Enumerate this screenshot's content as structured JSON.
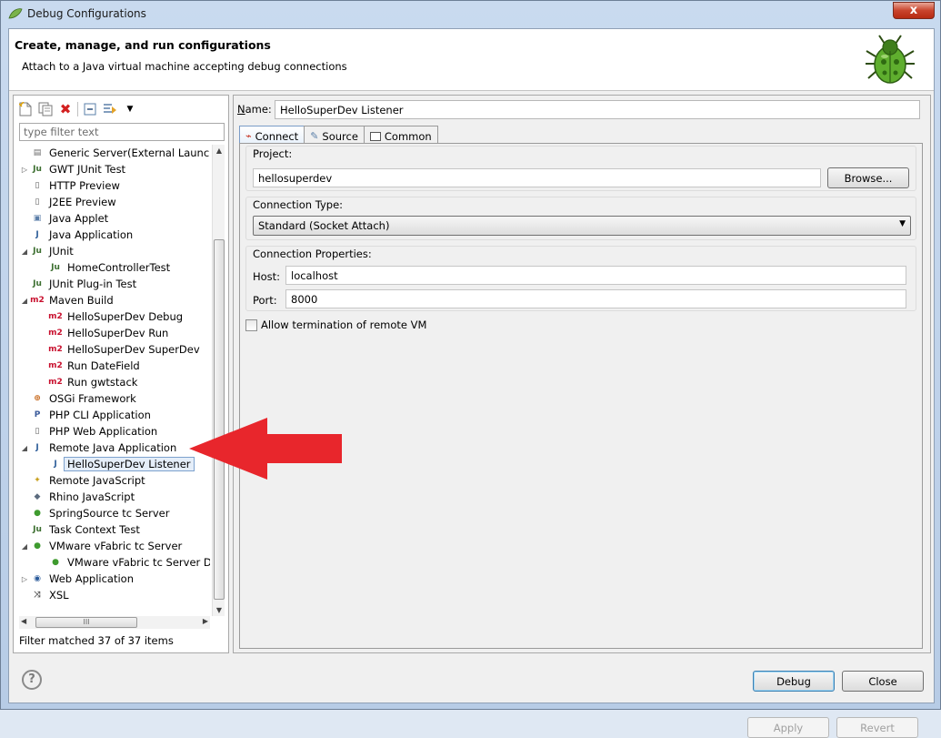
{
  "window": {
    "title": "Debug Configurations",
    "close_label": "x"
  },
  "header": {
    "title": "Create, manage, and run configurations",
    "subtitle": "Attach to a Java virtual machine accepting debug connections",
    "icon": "bug-icon"
  },
  "left": {
    "toolbar_icons": [
      "new-configuration-icon",
      "duplicate-icon",
      "delete-icon",
      "collapse-all-icon",
      "filter-icon",
      "dropdown-icon"
    ],
    "filter_placeholder": "type filter text",
    "tree": [
      {
        "label": "Generic Server(External Launch)",
        "icon": "server-icon",
        "level": 0,
        "twisty": "",
        "selected": false
      },
      {
        "label": "GWT JUnit Test",
        "icon": "junit-icon",
        "level": 0,
        "twisty": "closed",
        "selected": false
      },
      {
        "label": "HTTP Preview",
        "icon": "page-icon",
        "level": 0,
        "twisty": "",
        "selected": false
      },
      {
        "label": "J2EE Preview",
        "icon": "page-icon",
        "level": 0,
        "twisty": "",
        "selected": false
      },
      {
        "label": "Java Applet",
        "icon": "applet-icon",
        "level": 0,
        "twisty": "",
        "selected": false
      },
      {
        "label": "Java Application",
        "icon": "java-app-icon",
        "level": 0,
        "twisty": "",
        "selected": false
      },
      {
        "label": "JUnit",
        "icon": "junit-icon",
        "level": 0,
        "twisty": "open",
        "selected": false
      },
      {
        "label": "HomeControllerTest",
        "icon": "junit-icon",
        "level": 1,
        "twisty": "",
        "selected": false
      },
      {
        "label": "JUnit Plug-in Test",
        "icon": "junit-plugin-icon",
        "level": 0,
        "twisty": "",
        "selected": false
      },
      {
        "label": "Maven Build",
        "icon": "maven-icon",
        "level": 0,
        "twisty": "open",
        "selected": false
      },
      {
        "label": "HelloSuperDev Debug",
        "icon": "maven-icon",
        "level": 1,
        "twisty": "",
        "selected": false
      },
      {
        "label": "HelloSuperDev Run",
        "icon": "maven-icon",
        "level": 1,
        "twisty": "",
        "selected": false
      },
      {
        "label": "HelloSuperDev SuperDev",
        "icon": "maven-icon",
        "level": 1,
        "twisty": "",
        "selected": false
      },
      {
        "label": "Run DateField",
        "icon": "maven-icon",
        "level": 1,
        "twisty": "",
        "selected": false
      },
      {
        "label": "Run gwtstack",
        "icon": "maven-icon",
        "level": 1,
        "twisty": "",
        "selected": false
      },
      {
        "label": "OSGi Framework",
        "icon": "osgi-icon",
        "level": 0,
        "twisty": "",
        "selected": false
      },
      {
        "label": "PHP CLI Application",
        "icon": "php-icon",
        "level": 0,
        "twisty": "",
        "selected": false
      },
      {
        "label": "PHP Web Application",
        "icon": "page-icon",
        "level": 0,
        "twisty": "",
        "selected": false
      },
      {
        "label": "Remote Java Application",
        "icon": "remote-java-icon",
        "level": 0,
        "twisty": "open",
        "selected": false
      },
      {
        "label": "HelloSuperDev Listener",
        "icon": "remote-java-icon",
        "level": 1,
        "twisty": "",
        "selected": true
      },
      {
        "label": "Remote JavaScript",
        "icon": "javascript-icon",
        "level": 0,
        "twisty": "",
        "selected": false
      },
      {
        "label": "Rhino JavaScript",
        "icon": "rhino-icon",
        "level": 0,
        "twisty": "",
        "selected": false
      },
      {
        "label": "SpringSource tc Server",
        "icon": "spring-icon",
        "level": 0,
        "twisty": "",
        "selected": false
      },
      {
        "label": "Task Context Test",
        "icon": "junit-icon",
        "level": 0,
        "twisty": "",
        "selected": false
      },
      {
        "label": "VMware vFabric tc Server",
        "icon": "spring-icon",
        "level": 0,
        "twisty": "open",
        "selected": false
      },
      {
        "label": "VMware vFabric tc Server De",
        "icon": "spring-icon",
        "level": 1,
        "twisty": "",
        "selected": false
      },
      {
        "label": "Web Application",
        "icon": "globe-icon",
        "level": 0,
        "twisty": "closed",
        "selected": false
      },
      {
        "label": "XSL",
        "icon": "xsl-icon",
        "level": 0,
        "twisty": "",
        "selected": false
      }
    ],
    "hscroll_grip": "III",
    "filter_status": "Filter matched 37 of 37 items"
  },
  "right": {
    "name_label": "Name:",
    "name_value": "HelloSuperDev Listener",
    "tabs": [
      {
        "label": "Connect",
        "icon": "connect-icon",
        "active": true
      },
      {
        "label": "Source",
        "icon": "source-icon",
        "active": false
      },
      {
        "label": "Common",
        "icon": "common-icon",
        "active": false
      }
    ],
    "project_label": "Project:",
    "project_value": "hellosuperdev",
    "browse_label": "Browse...",
    "connection_type_label": "Connection Type:",
    "connection_type_value": "Standard (Socket Attach)",
    "connection_props_label": "Connection Properties:",
    "host_label": "Host:",
    "host_value": "localhost",
    "port_label": "Port:",
    "port_value": "8000",
    "allow_termination_label": "Allow termination of remote VM",
    "allow_termination_checked": false,
    "apply_label": "Apply",
    "revert_label": "Revert"
  },
  "footer": {
    "debug_label": "Debug",
    "close_label": "Close",
    "help_label": "?"
  },
  "colors": {
    "arrow": "#e8262c",
    "selection": "#e5eef9",
    "maven": "#c8102e"
  }
}
